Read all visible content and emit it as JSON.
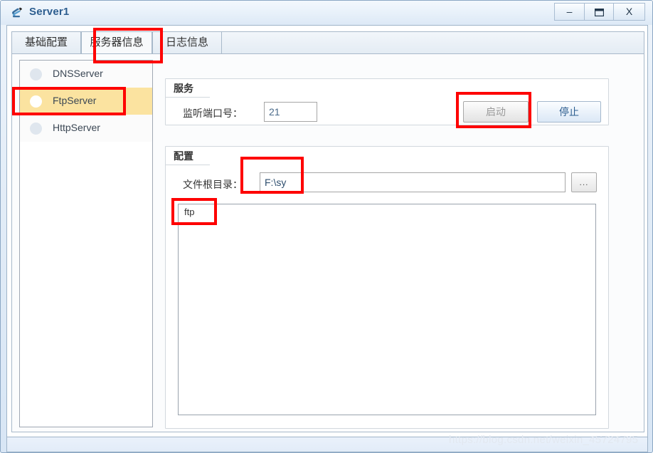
{
  "window": {
    "title": "Server1",
    "icon": "app-server-icon",
    "controls": {
      "minimize": "–",
      "maximize": "❐",
      "close": "X"
    }
  },
  "tabs": [
    {
      "label": "基础配置",
      "selected": false
    },
    {
      "label": "服务器信息",
      "selected": true
    },
    {
      "label": "日志信息",
      "selected": false
    }
  ],
  "sidebar": {
    "items": [
      {
        "label": "DNSServer",
        "selected": false
      },
      {
        "label": "FtpServer",
        "selected": true
      },
      {
        "label": "HttpServer",
        "selected": false
      }
    ]
  },
  "service_group": {
    "title": "服务",
    "port_label": "监听端口号：",
    "port_value": "21",
    "port_placeholder": "",
    "start_button": "启动",
    "stop_button": "停止"
  },
  "config_group": {
    "title": "配置",
    "rootdir_label": "文件根目录：",
    "rootdir_value": "F:\\sy",
    "rootdir_placeholder": "",
    "browse_button": "...",
    "file_list": [
      {
        "name": "ftp"
      }
    ]
  },
  "statusbar": {
    "text": ""
  },
  "watermark": "https://blog.csdn.net/weixin_45724795",
  "colors": {
    "selection_highlight": "#fbe3a0",
    "annotation_red": "#fe0000",
    "title_blue": "#2c5d8f",
    "stop_button_text": "#2c5d8f"
  }
}
